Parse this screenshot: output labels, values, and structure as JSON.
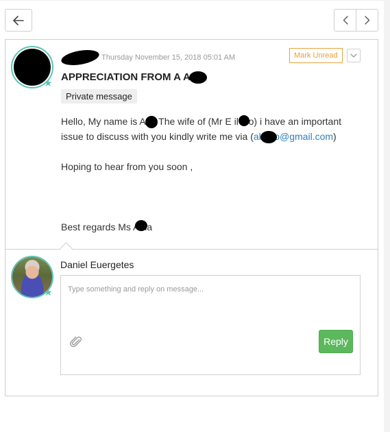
{
  "nav": {
    "back_icon": "arrow-left-icon",
    "prev_icon": "chevron-left-icon",
    "next_icon": "chevron-right-icon"
  },
  "message": {
    "date": "Thursday November 15, 2018 05:01 AM",
    "mark_unread_label": "Mark Unread",
    "subject": "APPRECIATION FROM A A.",
    "badge": "Private message",
    "body": {
      "line1": "Hello, My name is A  a, The wife of (Mr E  il Go) i have an important",
      "line2_prefix": "issue to discuss with you kindly write me via (",
      "line2_email": "al    goo@gmail.com",
      "line2_suffix": ")",
      "line3": "Hoping to hear from you soon ,",
      "signature": "Best regards Ms A  na"
    }
  },
  "reply": {
    "user_name": "Daniel Euergetes",
    "placeholder": "Type something and reply on message...",
    "button_label": "Reply"
  },
  "colors": {
    "accent_teal": "#5bc4b4",
    "mark_unread_orange": "#e6a23c",
    "reply_green": "#5cb85c",
    "link_blue": "#2f7fb8"
  }
}
